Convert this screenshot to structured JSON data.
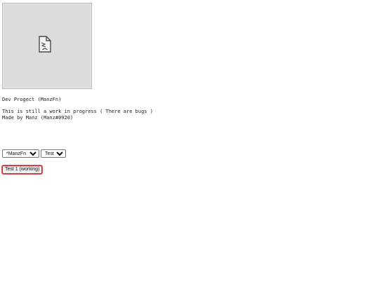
{
  "image": {
    "icon": "broken-image-icon"
  },
  "info": {
    "title": "Dev Progect (ManzFn)",
    "status": "This is still a work in progress ( There are bugs )",
    "credit": "Made by Manz (Manz#0920)"
  },
  "controls": {
    "user_select": {
      "selected": "*ManzFn",
      "options": [
        "*ManzFn"
      ]
    },
    "page_select": {
      "selected": "Test Page",
      "options": [
        "Test Page"
      ]
    },
    "test_button_label": "Test 1 (working)"
  },
  "colors": {
    "button_border": "#cc2a2a",
    "image_background": "#dcdcdc"
  }
}
